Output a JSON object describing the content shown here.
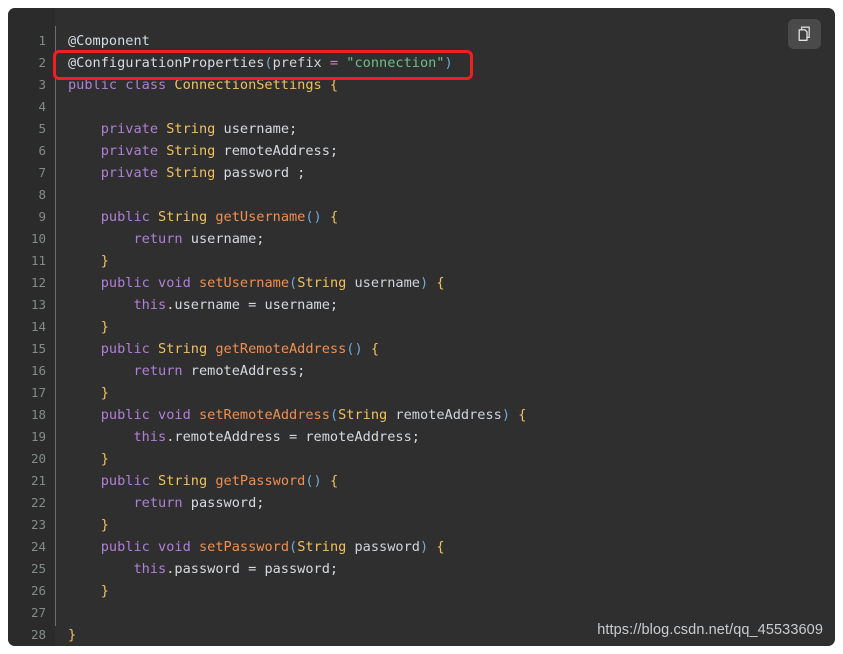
{
  "code_block": {
    "language": "java",
    "background_color": "#2f2f2f",
    "gutter_color": "#2b2b2b",
    "line_count": 28,
    "lines": [
      {
        "n": "1",
        "tokens": [
          {
            "t": "@Component",
            "c": "tk-ann"
          }
        ]
      },
      {
        "n": "2",
        "tokens": [
          {
            "t": "@ConfigurationProperties",
            "c": "tk-ann"
          },
          {
            "t": "(",
            "c": "tk-paren"
          },
          {
            "t": "prefix",
            "c": "tk-param"
          },
          {
            "t": " ",
            "c": "tk-plain"
          },
          {
            "t": "=",
            "c": "tk-op"
          },
          {
            "t": " ",
            "c": "tk-plain"
          },
          {
            "t": "\"connection\"",
            "c": "tk-str"
          },
          {
            "t": ")",
            "c": "tk-paren"
          }
        ]
      },
      {
        "n": "3",
        "tokens": [
          {
            "t": "public",
            "c": "tk-kw"
          },
          {
            "t": " ",
            "c": "tk-plain"
          },
          {
            "t": "class",
            "c": "tk-kw"
          },
          {
            "t": " ",
            "c": "tk-plain"
          },
          {
            "t": "ConnectionSettings",
            "c": "tk-type"
          },
          {
            "t": " ",
            "c": "tk-plain"
          },
          {
            "t": "{",
            "c": "tk-brace"
          }
        ]
      },
      {
        "n": "4",
        "tokens": []
      },
      {
        "n": "5",
        "tokens": [
          {
            "t": "    ",
            "c": "tk-plain"
          },
          {
            "t": "private",
            "c": "tk-kw"
          },
          {
            "t": " ",
            "c": "tk-plain"
          },
          {
            "t": "String",
            "c": "tk-type"
          },
          {
            "t": " username;",
            "c": "tk-plain"
          }
        ]
      },
      {
        "n": "6",
        "tokens": [
          {
            "t": "    ",
            "c": "tk-plain"
          },
          {
            "t": "private",
            "c": "tk-kw"
          },
          {
            "t": " ",
            "c": "tk-plain"
          },
          {
            "t": "String",
            "c": "tk-type"
          },
          {
            "t": " remoteAddress;",
            "c": "tk-plain"
          }
        ]
      },
      {
        "n": "7",
        "tokens": [
          {
            "t": "    ",
            "c": "tk-plain"
          },
          {
            "t": "private",
            "c": "tk-kw"
          },
          {
            "t": " ",
            "c": "tk-plain"
          },
          {
            "t": "String",
            "c": "tk-type"
          },
          {
            "t": " password ;",
            "c": "tk-plain"
          }
        ]
      },
      {
        "n": "8",
        "tokens": []
      },
      {
        "n": "9",
        "tokens": [
          {
            "t": "    ",
            "c": "tk-plain"
          },
          {
            "t": "public",
            "c": "tk-kw"
          },
          {
            "t": " ",
            "c": "tk-plain"
          },
          {
            "t": "String",
            "c": "tk-type"
          },
          {
            "t": " ",
            "c": "tk-plain"
          },
          {
            "t": "getUsername",
            "c": "tk-fn"
          },
          {
            "t": "()",
            "c": "tk-paren"
          },
          {
            "t": " ",
            "c": "tk-plain"
          },
          {
            "t": "{",
            "c": "tk-brace"
          }
        ]
      },
      {
        "n": "10",
        "tokens": [
          {
            "t": "        ",
            "c": "tk-plain"
          },
          {
            "t": "return",
            "c": "tk-kw"
          },
          {
            "t": " username;",
            "c": "tk-plain"
          }
        ]
      },
      {
        "n": "11",
        "tokens": [
          {
            "t": "    ",
            "c": "tk-plain"
          },
          {
            "t": "}",
            "c": "tk-brace"
          }
        ]
      },
      {
        "n": "12",
        "tokens": [
          {
            "t": "    ",
            "c": "tk-plain"
          },
          {
            "t": "public",
            "c": "tk-kw"
          },
          {
            "t": " ",
            "c": "tk-plain"
          },
          {
            "t": "void",
            "c": "tk-kw"
          },
          {
            "t": " ",
            "c": "tk-plain"
          },
          {
            "t": "setUsername",
            "c": "tk-fn"
          },
          {
            "t": "(",
            "c": "tk-paren"
          },
          {
            "t": "String",
            "c": "tk-type"
          },
          {
            "t": " username",
            "c": "tk-param"
          },
          {
            "t": ")",
            "c": "tk-paren"
          },
          {
            "t": " ",
            "c": "tk-plain"
          },
          {
            "t": "{",
            "c": "tk-brace"
          }
        ]
      },
      {
        "n": "13",
        "tokens": [
          {
            "t": "        ",
            "c": "tk-plain"
          },
          {
            "t": "this",
            "c": "tk-kw"
          },
          {
            "t": ".username = username;",
            "c": "tk-plain"
          }
        ]
      },
      {
        "n": "14",
        "tokens": [
          {
            "t": "    ",
            "c": "tk-plain"
          },
          {
            "t": "}",
            "c": "tk-brace"
          }
        ]
      },
      {
        "n": "15",
        "tokens": [
          {
            "t": "    ",
            "c": "tk-plain"
          },
          {
            "t": "public",
            "c": "tk-kw"
          },
          {
            "t": " ",
            "c": "tk-plain"
          },
          {
            "t": "String",
            "c": "tk-type"
          },
          {
            "t": " ",
            "c": "tk-plain"
          },
          {
            "t": "getRemoteAddress",
            "c": "tk-fn"
          },
          {
            "t": "()",
            "c": "tk-paren"
          },
          {
            "t": " ",
            "c": "tk-plain"
          },
          {
            "t": "{",
            "c": "tk-brace"
          }
        ]
      },
      {
        "n": "16",
        "tokens": [
          {
            "t": "        ",
            "c": "tk-plain"
          },
          {
            "t": "return",
            "c": "tk-kw"
          },
          {
            "t": " remoteAddress;",
            "c": "tk-plain"
          }
        ]
      },
      {
        "n": "17",
        "tokens": [
          {
            "t": "    ",
            "c": "tk-plain"
          },
          {
            "t": "}",
            "c": "tk-brace"
          }
        ]
      },
      {
        "n": "18",
        "tokens": [
          {
            "t": "    ",
            "c": "tk-plain"
          },
          {
            "t": "public",
            "c": "tk-kw"
          },
          {
            "t": " ",
            "c": "tk-plain"
          },
          {
            "t": "void",
            "c": "tk-kw"
          },
          {
            "t": " ",
            "c": "tk-plain"
          },
          {
            "t": "setRemoteAddress",
            "c": "tk-fn"
          },
          {
            "t": "(",
            "c": "tk-paren"
          },
          {
            "t": "String",
            "c": "tk-type"
          },
          {
            "t": " remoteAddress",
            "c": "tk-param"
          },
          {
            "t": ")",
            "c": "tk-paren"
          },
          {
            "t": " ",
            "c": "tk-plain"
          },
          {
            "t": "{",
            "c": "tk-brace"
          }
        ]
      },
      {
        "n": "19",
        "tokens": [
          {
            "t": "        ",
            "c": "tk-plain"
          },
          {
            "t": "this",
            "c": "tk-kw"
          },
          {
            "t": ".remoteAddress = remoteAddress;",
            "c": "tk-plain"
          }
        ]
      },
      {
        "n": "20",
        "tokens": [
          {
            "t": "    ",
            "c": "tk-plain"
          },
          {
            "t": "}",
            "c": "tk-brace"
          }
        ]
      },
      {
        "n": "21",
        "tokens": [
          {
            "t": "    ",
            "c": "tk-plain"
          },
          {
            "t": "public",
            "c": "tk-kw"
          },
          {
            "t": " ",
            "c": "tk-plain"
          },
          {
            "t": "String",
            "c": "tk-type"
          },
          {
            "t": " ",
            "c": "tk-plain"
          },
          {
            "t": "getPassword",
            "c": "tk-fn"
          },
          {
            "t": "()",
            "c": "tk-paren"
          },
          {
            "t": " ",
            "c": "tk-plain"
          },
          {
            "t": "{",
            "c": "tk-brace"
          }
        ]
      },
      {
        "n": "22",
        "tokens": [
          {
            "t": "        ",
            "c": "tk-plain"
          },
          {
            "t": "return",
            "c": "tk-kw"
          },
          {
            "t": " password;",
            "c": "tk-plain"
          }
        ]
      },
      {
        "n": "23",
        "tokens": [
          {
            "t": "    ",
            "c": "tk-plain"
          },
          {
            "t": "}",
            "c": "tk-brace"
          }
        ]
      },
      {
        "n": "24",
        "tokens": [
          {
            "t": "    ",
            "c": "tk-plain"
          },
          {
            "t": "public",
            "c": "tk-kw"
          },
          {
            "t": " ",
            "c": "tk-plain"
          },
          {
            "t": "void",
            "c": "tk-kw"
          },
          {
            "t": " ",
            "c": "tk-plain"
          },
          {
            "t": "setPassword",
            "c": "tk-fn"
          },
          {
            "t": "(",
            "c": "tk-paren"
          },
          {
            "t": "String",
            "c": "tk-type"
          },
          {
            "t": " password",
            "c": "tk-param"
          },
          {
            "t": ")",
            "c": "tk-paren"
          },
          {
            "t": " ",
            "c": "tk-plain"
          },
          {
            "t": "{",
            "c": "tk-brace"
          }
        ]
      },
      {
        "n": "25",
        "tokens": [
          {
            "t": "        ",
            "c": "tk-plain"
          },
          {
            "t": "this",
            "c": "tk-kw"
          },
          {
            "t": ".password = password;",
            "c": "tk-plain"
          }
        ]
      },
      {
        "n": "26",
        "tokens": [
          {
            "t": "    ",
            "c": "tk-plain"
          },
          {
            "t": "}",
            "c": "tk-brace"
          }
        ]
      },
      {
        "n": "27",
        "tokens": []
      },
      {
        "n": "28",
        "tokens": [
          {
            "t": "}",
            "c": "tk-brace"
          }
        ]
      }
    ]
  },
  "annotation": {
    "type": "red-rectangle-highlight",
    "color": "#f02020",
    "target_line": "2",
    "target_text": "@ConfigurationProperties(prefix = \"connection\")"
  },
  "copy_button": {
    "icon": "copy-icon",
    "tooltip": "Copy"
  },
  "watermark": {
    "text": "https://blog.csdn.net/qq_45533609"
  }
}
